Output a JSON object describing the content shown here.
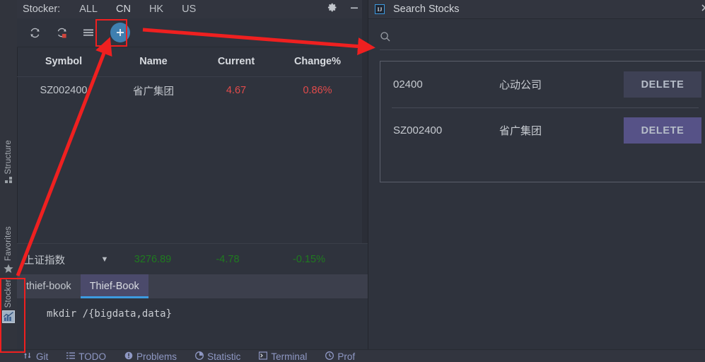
{
  "stocker": {
    "title": "Stocker:",
    "market_tabs": [
      {
        "label": "ALL",
        "active": false
      },
      {
        "label": "CN",
        "active": true
      },
      {
        "label": "HK",
        "active": false
      },
      {
        "label": "US",
        "active": false
      }
    ],
    "header_actions": [
      {
        "name": "settings-gear-icon",
        "label": "gear-icon"
      },
      {
        "name": "hide-window-icon",
        "label": "minus-icon"
      }
    ],
    "toolbar": [
      {
        "name": "refresh-icon",
        "label": "refresh"
      },
      {
        "name": "refresh-stop-icon",
        "label": "stop-refresh"
      },
      {
        "name": "menu-icon",
        "label": "menu"
      },
      {
        "name": "add-stock-icon",
        "label": "+"
      }
    ],
    "columns": [
      "Symbol",
      "Name",
      "Current",
      "Change%"
    ],
    "rows": [
      {
        "symbol": "SZ002400",
        "name": "省广集团",
        "current": "4.67",
        "change": "0.86%",
        "dir": "up"
      }
    ],
    "index_row": {
      "name": "上证指数",
      "caret": "▼",
      "current": "3276.89",
      "change": "-4.78",
      "percent": "-0.15%",
      "dir": "down"
    }
  },
  "tool_stripe": [
    {
      "label": "Structure",
      "icon": "structure-icon"
    },
    {
      "label": "Favorites",
      "icon": "star-icon"
    },
    {
      "label": "Stocker",
      "icon": "chart-icon"
    }
  ],
  "editor": {
    "tabs": [
      {
        "label": "thief-book",
        "active": false
      },
      {
        "label": "Thief-Book",
        "active": true
      }
    ],
    "content": "mkdir /{bigdata,data}"
  },
  "status_bar": [
    {
      "label": "Git",
      "icon": "git-icon"
    },
    {
      "label": "TODO",
      "icon": "todo-icon"
    },
    {
      "label": "Problems",
      "icon": "problems-icon"
    },
    {
      "label": "Statistic",
      "icon": "statistic-icon"
    },
    {
      "label": "Terminal",
      "icon": "terminal-icon"
    },
    {
      "label": "Prof",
      "icon": "profiler-icon"
    }
  ],
  "dialog": {
    "title": "Search Stocks",
    "app_icon": "IJ",
    "close_label": "✕",
    "search": {
      "value": "",
      "placeholder": "",
      "icon": "search-icon"
    },
    "rows": [
      {
        "code": "02400",
        "name": "心动公司",
        "delete_label": "DELETE",
        "state": "normal"
      },
      {
        "code": "SZ002400",
        "name": "省广集团",
        "delete_label": "DELETE",
        "state": "hovered"
      }
    ]
  },
  "annotations": {
    "accent_red": "#ef2020",
    "highlight_boxes": [
      "add-stock-button",
      "stocker-tool-stripe-button"
    ],
    "arrows": 2
  },
  "colors": {
    "background": "#2f333d",
    "header": "#32353f",
    "accent_blue": "#3d9ae0",
    "up_red": "#e24b4b",
    "down_green": "#1f7a1f",
    "delete_hover": "#565287",
    "delete_normal": "#3e4155"
  }
}
